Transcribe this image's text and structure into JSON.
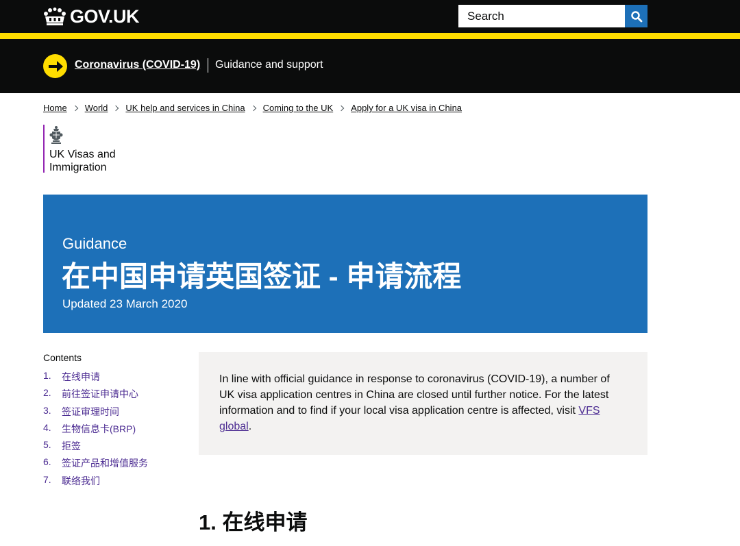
{
  "header": {
    "logo_text": "GOV.UK",
    "search_placeholder": "Search"
  },
  "covid_banner": {
    "link": "Coronavirus (COVID-19)",
    "text": "Guidance and support"
  },
  "breadcrumbs": [
    "Home",
    "World",
    "UK help and services in China",
    "Coming to the UK",
    "Apply for a UK visa in China"
  ],
  "organisation": {
    "name": "UK Visas and Immigration",
    "brand_color": "#9325b2"
  },
  "title_block": {
    "doc_type": "Guidance",
    "title": "在中国申请英国签证 - 申请流程",
    "updated": "Updated 23 March 2020"
  },
  "contents": {
    "title": "Contents",
    "items": [
      {
        "num": "1.",
        "label": "在线申请"
      },
      {
        "num": "2.",
        "label": "前往签证申请中心"
      },
      {
        "num": "3.",
        "label": "签证审理时间"
      },
      {
        "num": "4.",
        "label": "生物信息卡(BRP)"
      },
      {
        "num": "5.",
        "label": "拒签"
      },
      {
        "num": "6.",
        "label": "签证产品和增值服务"
      },
      {
        "num": "7.",
        "label": "联络我们"
      }
    ]
  },
  "notice": {
    "text_before": "In line with official guidance in response to coronavirus (COVID-19), a number of UK visa application centres in China are closed until further notice. For the latest information and to find if your local visa application centre is affected, visit ",
    "link": "VFS global",
    "text_after": "."
  },
  "section": {
    "heading": "1. 在线申请"
  },
  "colors": {
    "header_bg": "#0b0c0c",
    "accent_yellow": "#ffdd00",
    "gov_blue": "#1d70b8",
    "link_purple": "#4c2c92",
    "notice_bg": "#f3f2f1"
  }
}
